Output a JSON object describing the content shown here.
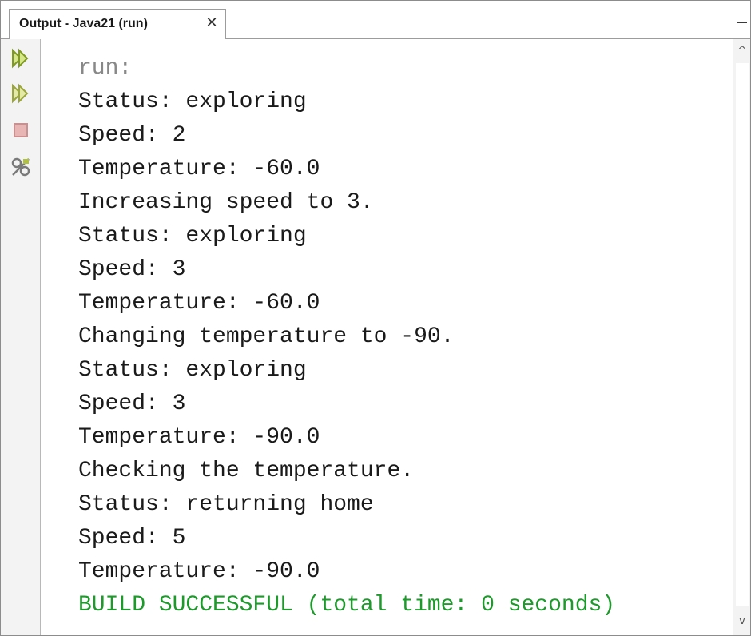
{
  "window": {
    "tab_title": "Output - Java21 (run)",
    "close_glyph": "✕",
    "minimize_glyph": "—"
  },
  "toolbar": {
    "items": [
      {
        "name": "rerun-icon",
        "color": "#a8c43a"
      },
      {
        "name": "rerun-with-options-icon",
        "color": "#a8c43a"
      },
      {
        "name": "stop-icon",
        "color": "#d9a0a0"
      },
      {
        "name": "settings-icon",
        "color": "#8a8a8a"
      }
    ]
  },
  "output": {
    "lines": [
      {
        "text": "run:",
        "style": "gray"
      },
      {
        "text": "Status: exploring",
        "style": "normal"
      },
      {
        "text": "Speed: 2",
        "style": "normal"
      },
      {
        "text": "Temperature: -60.0",
        "style": "normal"
      },
      {
        "text": "Increasing speed to 3.",
        "style": "normal"
      },
      {
        "text": "Status: exploring",
        "style": "normal"
      },
      {
        "text": "Speed: 3",
        "style": "normal"
      },
      {
        "text": "Temperature: -60.0",
        "style": "normal"
      },
      {
        "text": "Changing temperature to -90.",
        "style": "normal"
      },
      {
        "text": "Status: exploring",
        "style": "normal"
      },
      {
        "text": "Speed: 3",
        "style": "normal"
      },
      {
        "text": "Temperature: -90.0",
        "style": "normal"
      },
      {
        "text": "Checking the temperature.",
        "style": "normal"
      },
      {
        "text": "Status: returning home",
        "style": "normal"
      },
      {
        "text": "Speed: 5",
        "style": "normal"
      },
      {
        "text": "Temperature: -90.0",
        "style": "normal"
      },
      {
        "text": "BUILD SUCCESSFUL (total time: 0 seconds)",
        "style": "green"
      }
    ]
  },
  "scrollbar": {
    "up_glyph": "^",
    "down_glyph": "v"
  },
  "colors": {
    "success_green": "#1e9a2c",
    "run_gray": "#888888",
    "text": "#1a1a1a"
  }
}
